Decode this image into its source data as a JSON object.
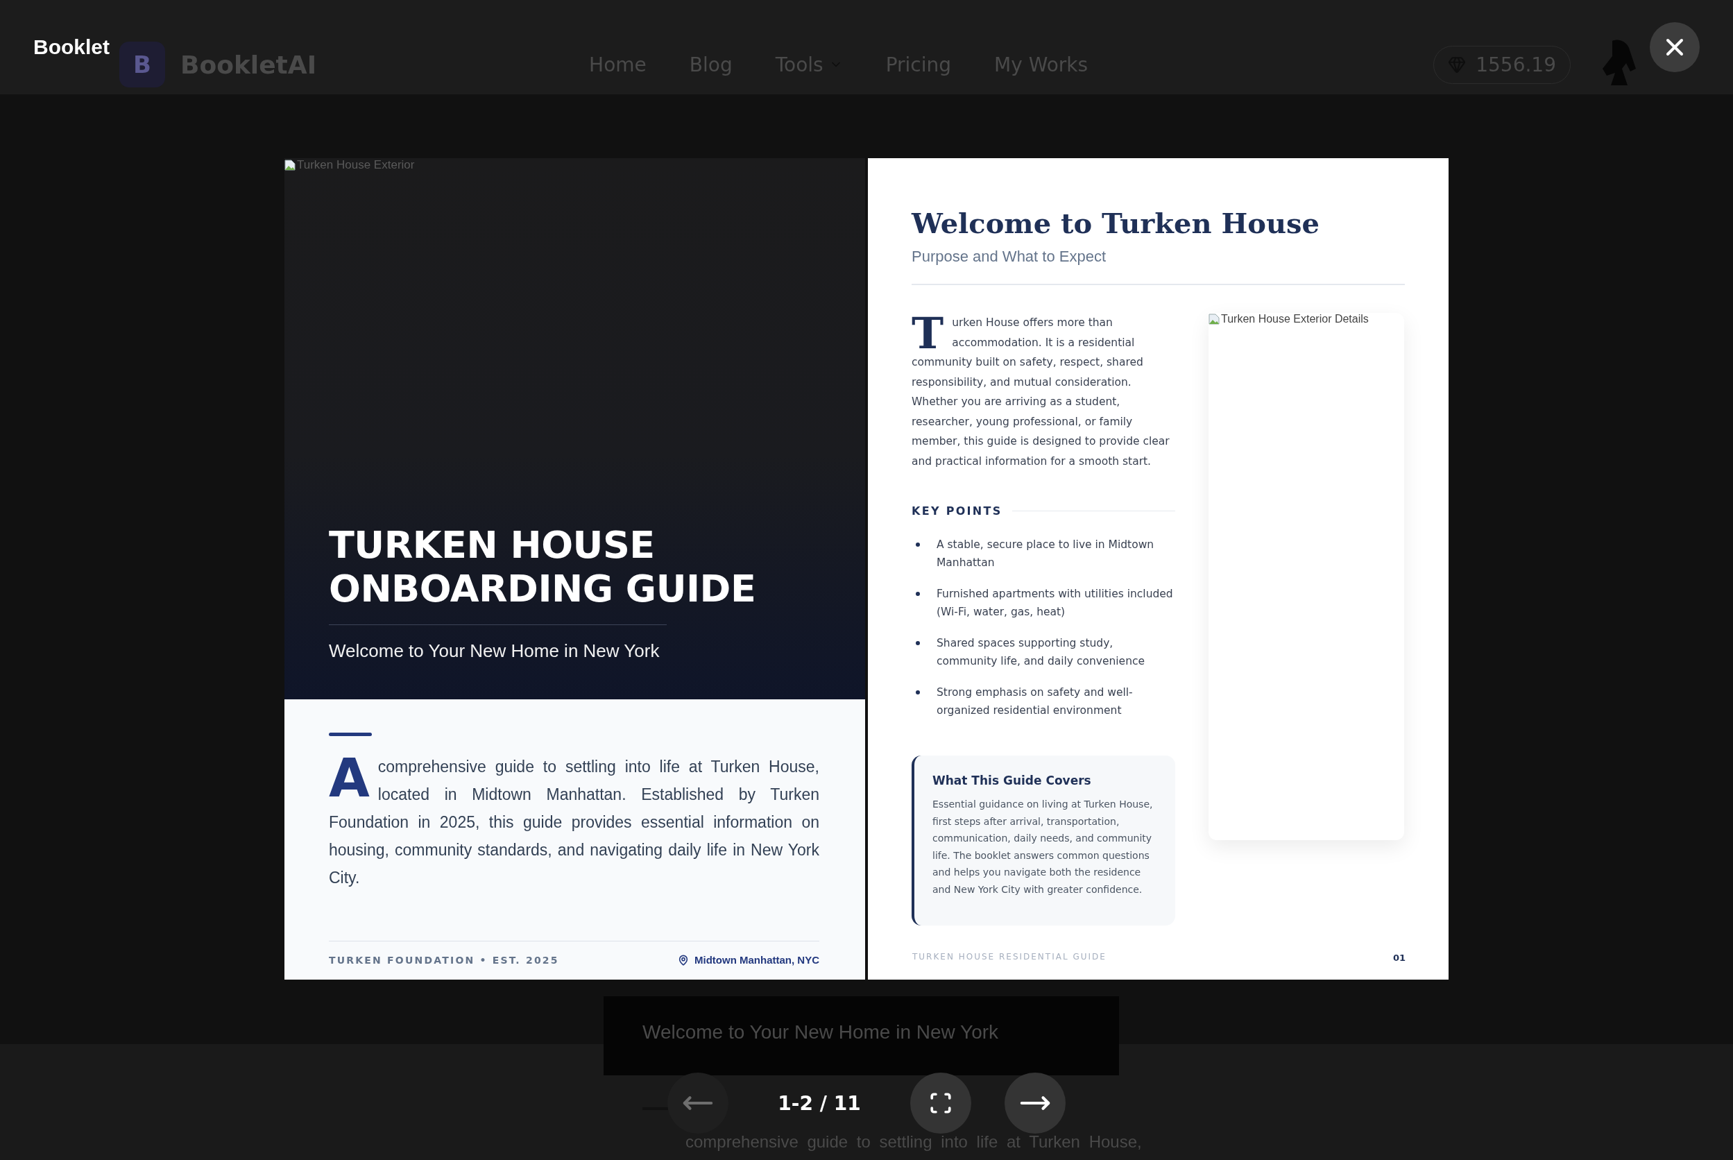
{
  "background_site": {
    "logo_mark": "B",
    "logo": "BookletAI",
    "nav": [
      {
        "label": "Home",
        "kind": "link"
      },
      {
        "label": "Blog",
        "kind": "link"
      },
      {
        "label": "Tools",
        "kind": "dropdown"
      },
      {
        "label": "Pricing",
        "kind": "link"
      },
      {
        "label": "My Works",
        "kind": "link"
      }
    ],
    "credits": "1556.19",
    "ghost_page": {
      "subtitle": "Welcome to Your New Home in New York",
      "text": "comprehensive guide to settling into life at Turken House,"
    }
  },
  "viewer": {
    "title": "Booklet",
    "left_page": {
      "image_alt": "Turken House Exterior",
      "title": "TURKEN HOUSE ONBOARDING GUIDE",
      "subtitle": "Welcome to Your New Home in New York",
      "drop_cap": "A",
      "text": "comprehensive guide to settling into life at Turken House, located in Midtown Manhattan. Established by Turken Foundation in 2025, this guide provides essential information on housing, community standards, and navigating daily life in New York City.",
      "footer_left": "TURKEN FOUNDATION • EST. 2025",
      "footer_right": "Midtown Manhattan, NYC"
    },
    "right_page": {
      "title": "Welcome to Turken House",
      "subtitle": "Purpose and What to Expect",
      "drop_cap": "T",
      "text": "urken House offers more than accommodation. It is a residential community built on safety, respect, shared responsibility, and mutual consideration. Whether you are arriving as a student, researcher, young professional, or family member, this guide is designed to provide clear and practical information for a smooth start.",
      "key_points_heading": "KEY POINTS",
      "key_points": [
        "A stable, secure place to live in Midtown Manhattan",
        "Furnished apartments with utilities included (Wi-Fi, water, gas, heat)",
        "Shared spaces supporting study, community life, and daily convenience",
        "Strong emphasis on safety and well-organized residential environment"
      ],
      "callout": {
        "title": "What This Guide Covers",
        "text": "Essential guidance on living at Turken House, first steps after arrival, transportation, communication, daily needs, and community life. The booklet answers common questions and helps you navigate both the residence and New York City with greater confidence."
      },
      "image_alt": "Turken House Exterior Details",
      "footer": "TURKEN HOUSE RESIDENTIAL GUIDE",
      "page_number": "01"
    },
    "controls": {
      "prev": {
        "disabled": true
      },
      "counter": "1-2 / 11",
      "next": {
        "disabled": false
      }
    }
  }
}
